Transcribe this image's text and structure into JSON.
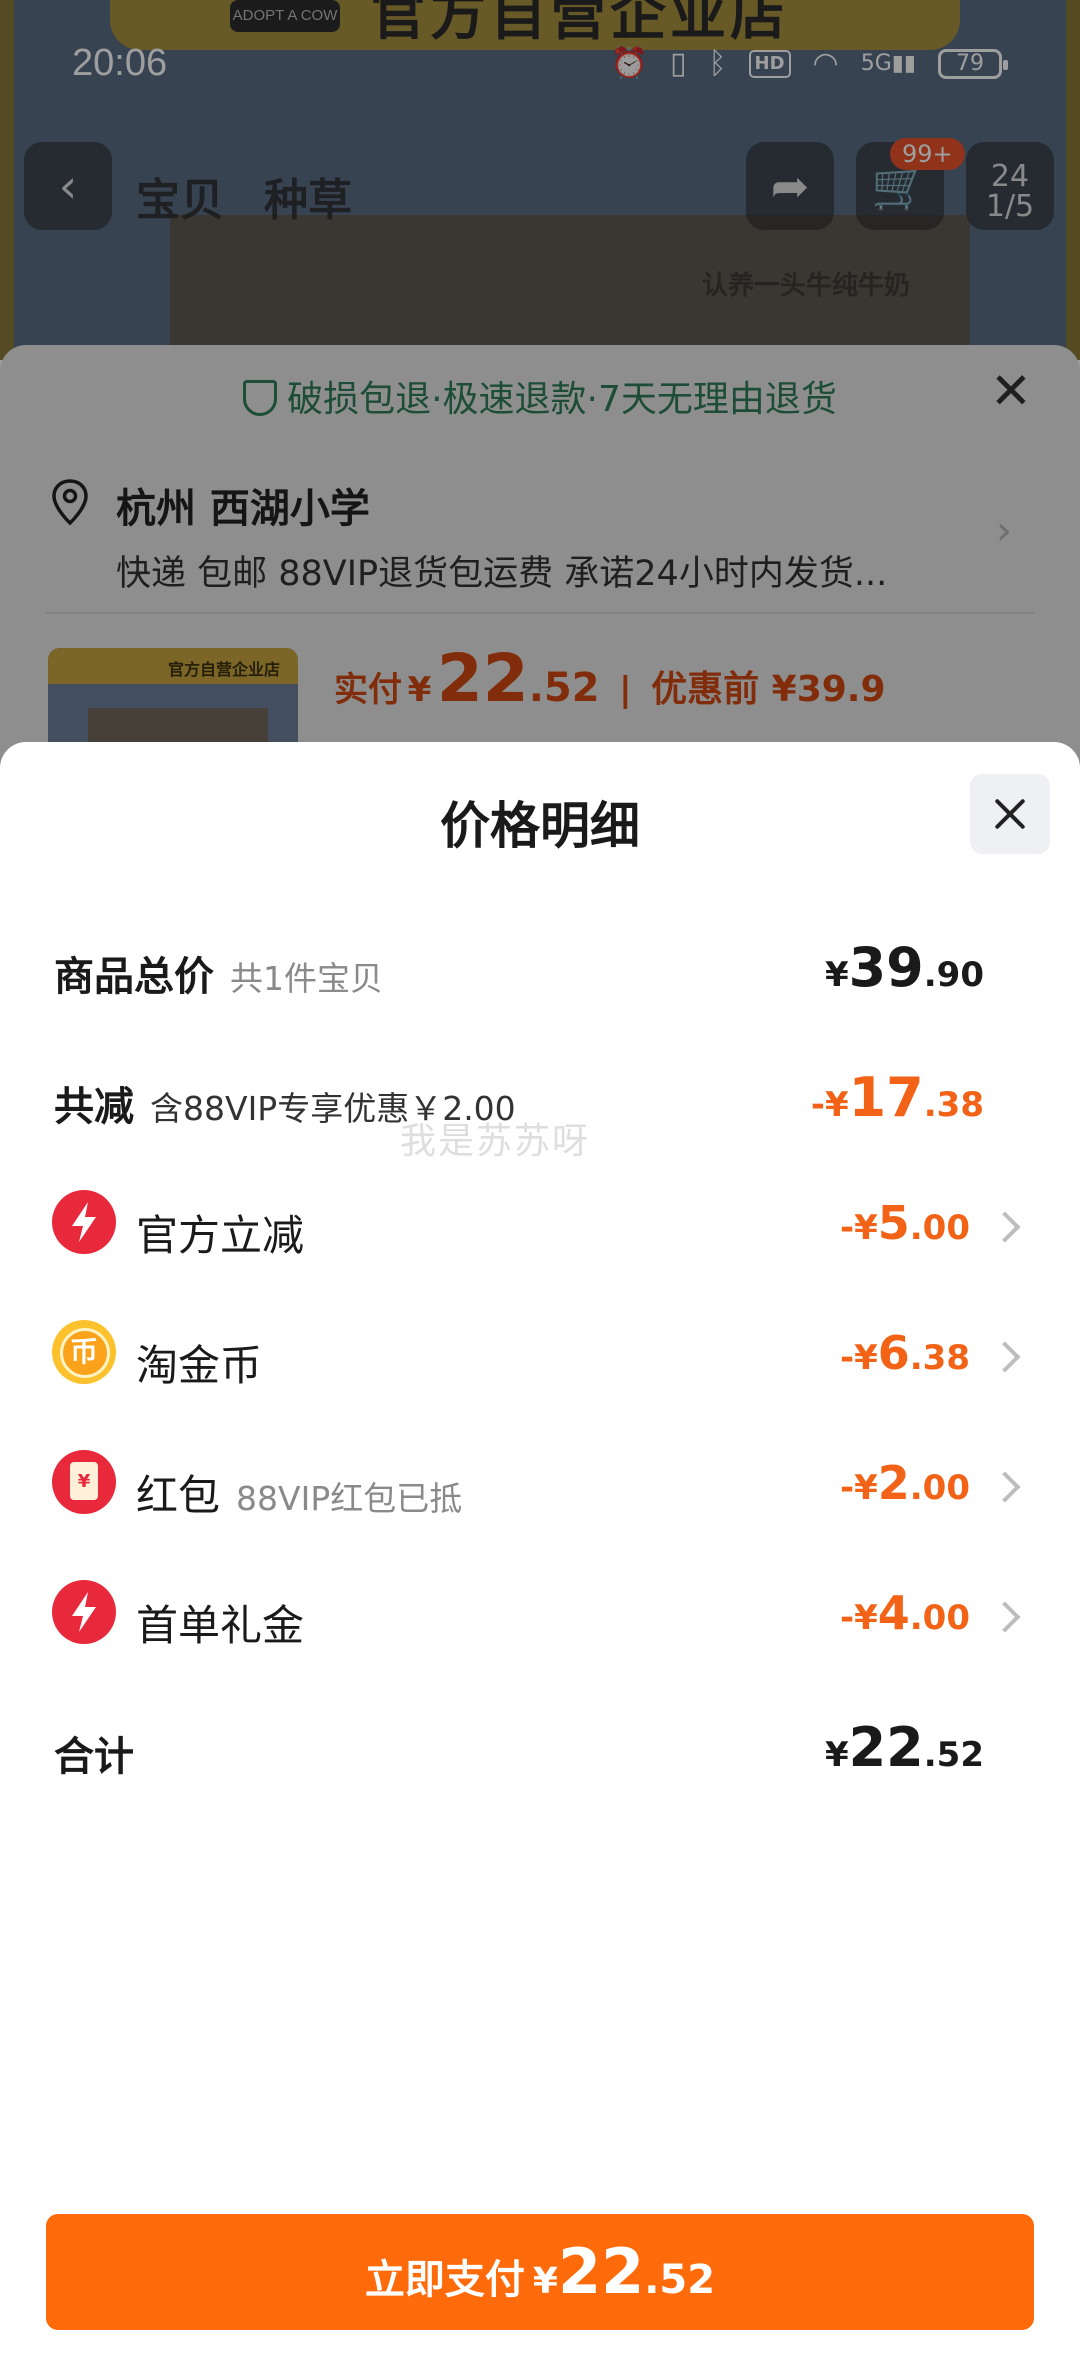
{
  "status_bar": {
    "time": "20:06",
    "battery": "79",
    "network": "5G",
    "hd": "HD"
  },
  "background_page": {
    "banner_pill": "ADOPT A COW",
    "banner_text": "官方自营企业店",
    "nav_tabs": [
      "宝贝",
      "种草"
    ],
    "cart_badge": "99+",
    "nav_badge_top": "24",
    "nav_badge_bottom": "1/5",
    "box_text": "认养一头牛纯牛奶"
  },
  "checkout_sheet": {
    "guarantee": "破损包退·极速退款·7天无理由退货",
    "address_title": "杭州 西湖小学",
    "address_sub": "快递 包邮 88VIP退货包运费 承诺24小时内发货...",
    "thumb_strip": "官方自营企业店",
    "pay_label": "实付",
    "pay_currency": "¥",
    "pay_int": "22",
    "pay_dec": ".52",
    "orig_price": "优惠前 ¥39.9"
  },
  "price_detail": {
    "title": "价格明细",
    "watermark": "我是苏苏呀",
    "total_goods": {
      "label": "商品总价",
      "note": "共1件宝贝",
      "currency": "¥",
      "int": "39",
      "dec": ".90"
    },
    "total_reduction": {
      "label": "共减",
      "note": "含88VIP专享优惠￥2.00",
      "currency": "-¥",
      "int": "17",
      "dec": ".38"
    },
    "items": [
      {
        "label": "官方立减",
        "note": "",
        "currency": "-¥",
        "int": "5",
        "dec": ".00",
        "icon": "lightning-icon"
      },
      {
        "label": "淘金币",
        "note": "",
        "currency": "-¥",
        "int": "6",
        "dec": ".38",
        "icon": "coin-icon"
      },
      {
        "label": "红包",
        "note": "88VIP红包已抵",
        "currency": "-¥",
        "int": "2",
        "dec": ".00",
        "icon": "red-packet-icon"
      },
      {
        "label": "首单礼金",
        "note": "",
        "currency": "-¥",
        "int": "4",
        "dec": ".00",
        "icon": "lightning-icon"
      }
    ],
    "grand_total": {
      "label": "合计",
      "currency": "¥",
      "int": "22",
      "dec": ".52"
    }
  },
  "pay_button": {
    "label": "立即支付",
    "currency": "¥",
    "int": "22",
    "dec": ".52"
  },
  "colors": {
    "accent_orange": "#ff6a0a",
    "discount_orange": "#f26317",
    "guarantee_green": "#2f7d57",
    "icon_red": "#e8293b"
  }
}
